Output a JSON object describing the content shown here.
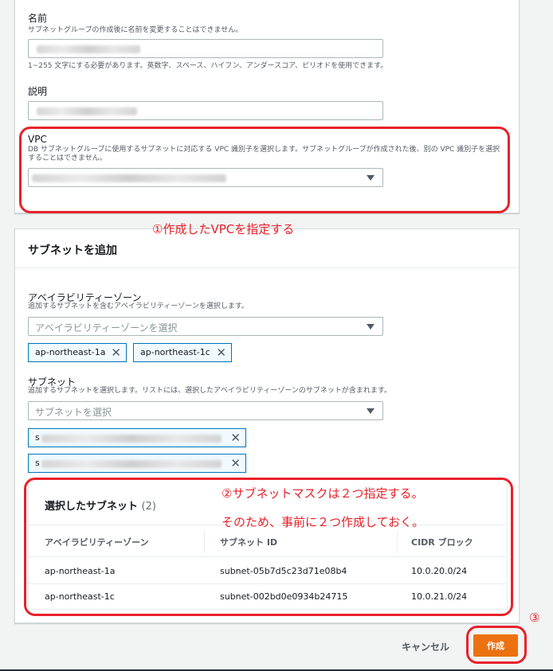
{
  "details": {
    "name_label": "名前",
    "name_desc": "サブネットグループの作成後に名前を変更することはできません。",
    "name_hint": "1~255 文字にする必要があります。英数字、スペース、ハイフン、アンダースコア、ピリオドを使用できます。",
    "desc_label": "説明",
    "vpc_label": "VPC",
    "vpc_desc": "DB サブネットグループに使用するサブネットに対応する VPC 識別子を選択します。サブネットグループが作成された後、別の VPC 識別子を選択することはできません。"
  },
  "subnet_section": {
    "title": "サブネットを追加",
    "az_label": "アベイラビリティーゾーン",
    "az_desc": "追加するサブネットを含むアベイラビリティーゾーンを選択します。",
    "az_placeholder": "アベイラビリティーゾーンを選択",
    "az_tokens": [
      "ap-northeast-1a",
      "ap-northeast-1c"
    ],
    "subnet_label": "サブネット",
    "subnet_desc": "追加するサブネットを選択します。リストには、選択したアベイラビリティーゾーンのサブネットが含まれます。",
    "subnet_placeholder": "サブネットを選択",
    "subnet_token_prefix": "s"
  },
  "selected": {
    "title": "選択したサブネット",
    "count": "(2)",
    "columns": [
      "アベイラビリティーゾーン",
      "サブネット ID",
      "CIDR ブロック"
    ],
    "rows": [
      [
        "ap-northeast-1a",
        "subnet-05b7d5c23d71e08b4",
        "10.0.20.0/24"
      ],
      [
        "ap-northeast-1c",
        "subnet-002bd0e0934b24715",
        "10.0.21.0/24"
      ]
    ]
  },
  "annotations": {
    "step1": "①作成したVPCを指定する",
    "step2_line1": "②サブネットマスクは２つ指定する。",
    "step2_line2": "そのため、事前に２つ作成しておく。",
    "step3": "③"
  },
  "actions": {
    "cancel": "キャンセル",
    "create": "作成"
  },
  "colors": {
    "primary_button": "#ec7211",
    "token_border": "#0073bb",
    "annotation": "#e8212a"
  },
  "icons": {
    "dropdown": "caret-down-icon",
    "remove": "close-icon"
  }
}
